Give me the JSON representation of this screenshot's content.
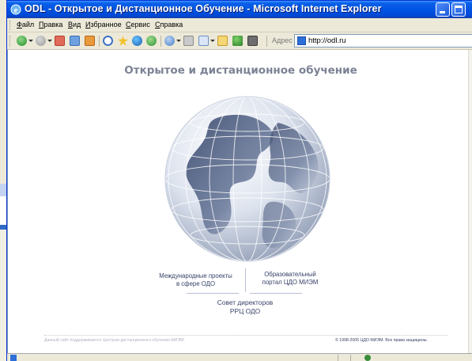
{
  "window": {
    "title": "ODL - Открытое и Дистанционное Обучение - Microsoft Internet Explorer"
  },
  "menu": {
    "items": [
      {
        "label": "Файл",
        "accel": "Ф",
        "rest": "айл"
      },
      {
        "label": "Правка",
        "accel": "П",
        "rest": "равка"
      },
      {
        "label": "Вид",
        "accel": "В",
        "rest": "ид"
      },
      {
        "label": "Избранное",
        "accel": "И",
        "rest": "збранное"
      },
      {
        "label": "Сервис",
        "accel": "С",
        "rest": "ервис"
      },
      {
        "label": "Справка",
        "accel": "С",
        "rest": "правка"
      }
    ]
  },
  "toolbar": {
    "buttons": [
      "back-icon",
      "forward-icon",
      "stop-icon",
      "refresh-icon",
      "home-icon",
      "search-icon",
      "favorites-icon",
      "media-icon",
      "history-icon",
      "mail-icon",
      "print-icon",
      "edit-icon",
      "folder-icon",
      "messenger-icon",
      "research-icon"
    ],
    "address_label": "Адрес",
    "address_value": "http://odl.ru"
  },
  "page": {
    "heading": "Открытое и дистанционное обучение",
    "links": {
      "international_line1": "Международные проекты",
      "international_line2": "в сфере ОДО",
      "educational_line1": "Образовательный",
      "educational_line2": "портал ЦДО МИЭМ",
      "council_line1": "Совет директоров",
      "council_line2": "РРЦ ОДО"
    },
    "footer_left": "Данный сайт поддерживается Центром дистанционного обучения МИЭМ.",
    "footer_right": "© 1998-2005 ЦДО МИЭМ. Все права защищены."
  },
  "colors": {
    "titlebar": "#0054e3",
    "heading": "#7b8294",
    "link": "#374269"
  }
}
